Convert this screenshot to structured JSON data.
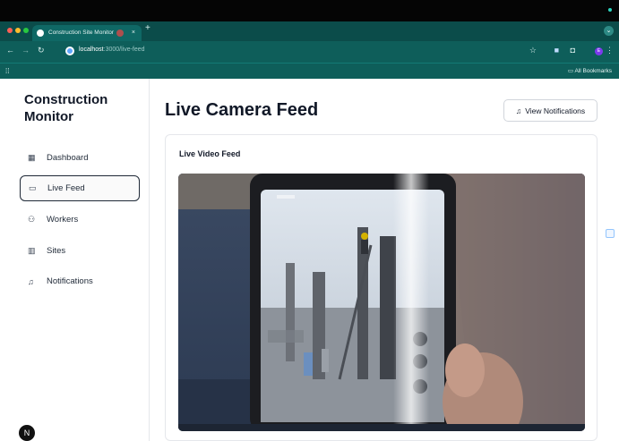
{
  "browser": {
    "tab_title": "Construction Site Monitor",
    "tab_close": "×",
    "new_tab": "+",
    "url_host": "localhost",
    "url_path": ":3000/live-feed",
    "all_bookmarks": "All Bookmarks",
    "profile_initial": "E"
  },
  "sidebar": {
    "brand": "Construction Monitor",
    "items": [
      {
        "label": "Dashboard",
        "icon": "grid-icon",
        "glyph": "▦"
      },
      {
        "label": "Live Feed",
        "icon": "video-icon",
        "glyph": "▭"
      },
      {
        "label": "Workers",
        "icon": "users-icon",
        "glyph": "⚇"
      },
      {
        "label": "Sites",
        "icon": "building-icon",
        "glyph": "▥"
      },
      {
        "label": "Notifications",
        "icon": "bell-icon",
        "glyph": "♫"
      }
    ],
    "active": "Live Feed",
    "logo_glyph": "N"
  },
  "main": {
    "title": "Live Camera Feed",
    "notif_button": "View Notifications",
    "card_title": "Live Video Feed"
  },
  "colors": {
    "browser_chrome": "#0e5e5a",
    "text_primary": "#111827",
    "border": "#e5e7eb"
  }
}
